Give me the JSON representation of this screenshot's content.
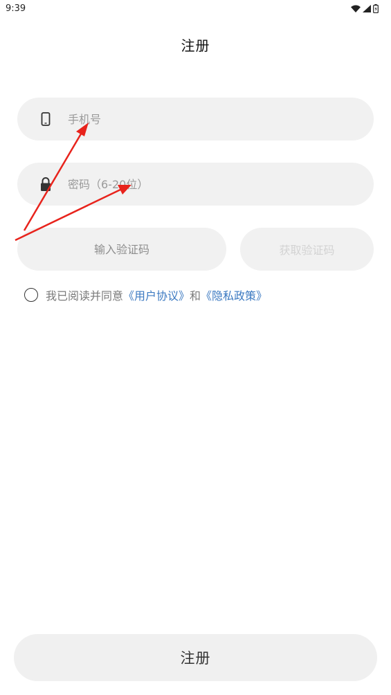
{
  "status_bar": {
    "time": "9:39",
    "icons": [
      "wifi-icon",
      "signal-icon",
      "battery-icon"
    ]
  },
  "header": {
    "title": "注册"
  },
  "form": {
    "phone": {
      "placeholder": "手机号",
      "value": "",
      "icon": "phone-icon"
    },
    "password": {
      "placeholder": "密码（6-20位）",
      "value": "",
      "icon": "lock-icon"
    },
    "code": {
      "placeholder": "输入验证码",
      "value": ""
    },
    "get_code_label": "获取验证码"
  },
  "agreement": {
    "checked": false,
    "prefix": "我已阅读并同意",
    "user_agreement": "《用户协议》",
    "and": "和",
    "privacy_policy": "《隐私政策》"
  },
  "submit": {
    "label": "注册"
  },
  "colors": {
    "background": "#ffffff",
    "field_bg": "#f1f1f1",
    "link": "#3b79c1",
    "disabled_text": "#d3d3d3",
    "annotation_arrow": "#e8231c"
  }
}
